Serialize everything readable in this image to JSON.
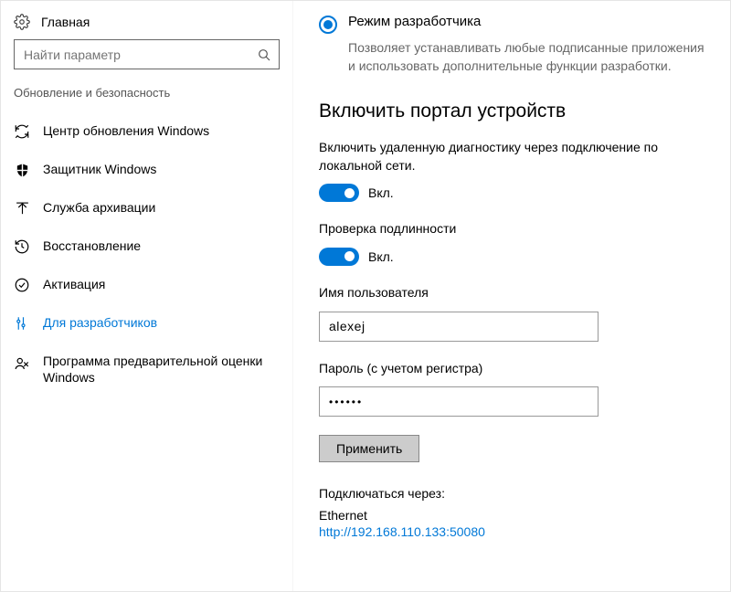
{
  "sidebar": {
    "home_label": "Главная",
    "search_placeholder": "Найти параметр",
    "section_title": "Обновление и безопасность",
    "items": [
      {
        "label": "Центр обновления Windows"
      },
      {
        "label": "Защитник Windows"
      },
      {
        "label": "Служба архивации"
      },
      {
        "label": "Восстановление"
      },
      {
        "label": "Активация"
      },
      {
        "label": "Для разработчиков"
      },
      {
        "label": "Программа предварительной оценки Windows"
      }
    ]
  },
  "dev_mode": {
    "radio_label": "Режим разработчика",
    "radio_desc": "Позволяет устанавливать любые подписанные приложения и использовать дополнительные функции разработки."
  },
  "portal": {
    "heading": "Включить портал устройств",
    "remote_diag_label": "Включить удаленную диагностику через подключение по локальной сети.",
    "toggle_on": "Вкл.",
    "auth_label": "Проверка подлинности",
    "username_label": "Имя пользователя",
    "username_value": "alexej",
    "password_label": "Пароль (с учетом регистра)",
    "password_mask": "••••••",
    "apply_label": "Применить",
    "connect_via_label": "Подключаться через:",
    "connect_type": "Ethernet",
    "connect_url": "http://192.168.110.133:50080"
  }
}
